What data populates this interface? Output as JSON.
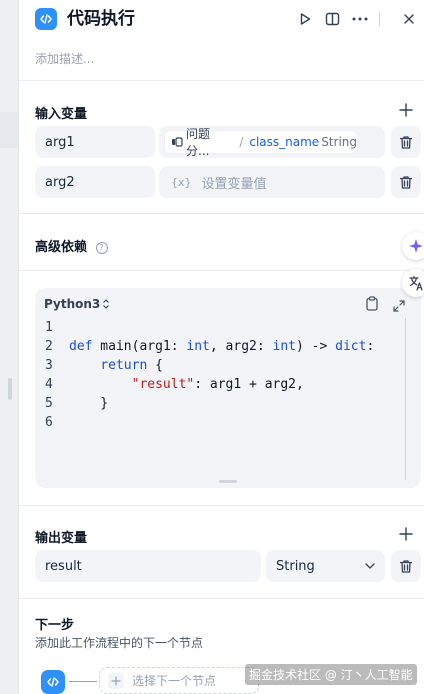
{
  "header": {
    "title": "代码执行",
    "description_placeholder": "添加描述..."
  },
  "input_vars": {
    "title": "输入变量",
    "rows": [
      {
        "name": "arg1",
        "source_node": "问题分...",
        "separator": "/",
        "variable": "class_name",
        "type": "String"
      },
      {
        "name": "arg2",
        "value_placeholder": "设置变量值",
        "value_icon": "{x}"
      }
    ]
  },
  "advanced": {
    "title": "高级依赖",
    "help_icon": "?"
  },
  "editor": {
    "language": "Python3",
    "lines": [
      {
        "num": "1",
        "tokens": []
      },
      {
        "num": "2",
        "tokens": [
          {
            "t": "def",
            "c": "kw"
          },
          {
            "t": " main(arg1: ",
            "c": "txt"
          },
          {
            "t": "int",
            "c": "kw"
          },
          {
            "t": ", arg2: ",
            "c": "txt"
          },
          {
            "t": "int",
            "c": "kw"
          },
          {
            "t": ") -> ",
            "c": "txt"
          },
          {
            "t": "dict",
            "c": "kw"
          },
          {
            "t": ":",
            "c": "txt"
          }
        ]
      },
      {
        "num": "3",
        "tokens": [
          {
            "t": "    ",
            "c": "txt"
          },
          {
            "t": "return",
            "c": "kw"
          },
          {
            "t": " {",
            "c": "txt"
          }
        ]
      },
      {
        "num": "4",
        "tokens": [
          {
            "t": "        ",
            "c": "txt"
          },
          {
            "t": "\"result\"",
            "c": "str"
          },
          {
            "t": ": arg1 + arg2,",
            "c": "txt"
          }
        ]
      },
      {
        "num": "5",
        "tokens": [
          {
            "t": "    }",
            "c": "txt"
          }
        ]
      },
      {
        "num": "6",
        "tokens": []
      }
    ]
  },
  "output_vars": {
    "title": "输出变量",
    "rows": [
      {
        "name": "result",
        "type": "String"
      }
    ]
  },
  "next_step": {
    "title": "下一步",
    "description": "添加此工作流程中的下一个节点",
    "select_label": "选择下一个节点"
  },
  "watermark": "掘金技术社区 @ 汀丶人工智能",
  "colors": {
    "accent": "#2e90fa",
    "keyword": "#1d4ed8",
    "string": "#b91c1c",
    "field_bg": "#f2f4f7"
  }
}
